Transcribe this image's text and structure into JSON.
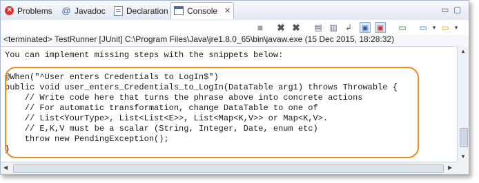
{
  "tabs": [
    {
      "label": "Problems",
      "icon": "problems-icon"
    },
    {
      "label": "Javadoc",
      "icon": "javadoc-icon"
    },
    {
      "label": "Declaration",
      "icon": "declaration-icon"
    },
    {
      "label": "Console",
      "icon": "console-icon",
      "active": true
    }
  ],
  "console": {
    "status": "<terminated> TestRunner [JUnit] C:\\Program Files\\Java\\jre1.8.0_65\\bin\\javaw.exe (15 Dec 2015, 18:28:32)",
    "lines": [
      "You can implement missing steps with the snippets below:",
      "",
      "@When(\"^User enters Credentials to LogIn$\")",
      "public void user_enters_Credentials_to_LogIn(DataTable arg1) throws Throwable {",
      "    // Write code here that turns the phrase above into concrete actions",
      "    // For automatic transformation, change DataTable to one of",
      "    // List<YourType>, List<List<E>>, List<Map<K,V>> or Map<K,V>.",
      "    // E,K,V must be a scalar (String, Integer, Date, enum etc)",
      "    throw new PendingException();",
      "}"
    ]
  },
  "colors": {
    "highlight": "#f08a24",
    "active_tab": "#ffffff"
  }
}
